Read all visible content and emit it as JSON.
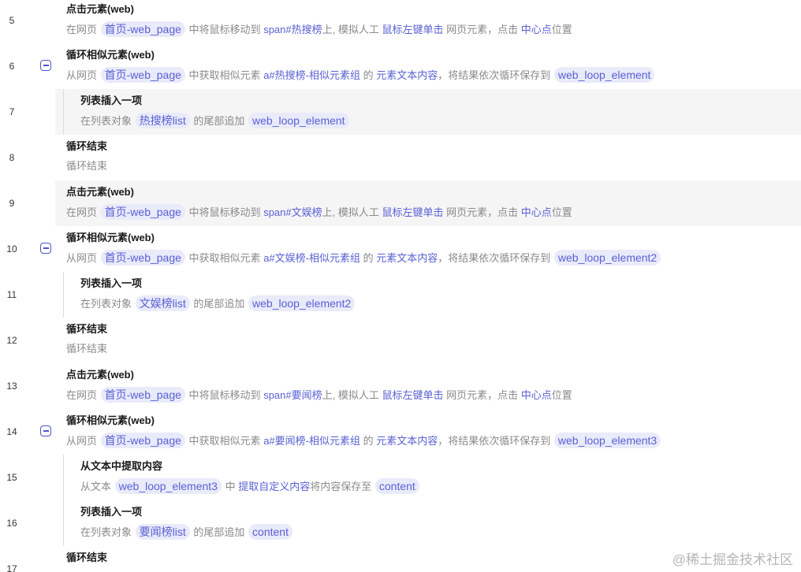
{
  "watermark": "@稀土掘金技术社区",
  "rows": {
    "r5": {
      "num": "5",
      "title": "点击元素(web)",
      "d": [
        "在网页",
        "首页-web_page",
        "中将鼠标移动到",
        "span#热搜榜",
        "上, 模拟人工",
        "鼠标左键",
        "单击",
        "网页元素，点击",
        "中心点",
        "位置"
      ]
    },
    "r6": {
      "num": "6",
      "title": "循环相似元素(web)",
      "d": [
        "从网页",
        "首页-web_page",
        "中获取相似元素",
        "a#热搜榜-相似元素组",
        "的",
        "元素文本内容",
        "，将结果依次循环保存到",
        "web_loop_element"
      ]
    },
    "r7": {
      "num": "7",
      "title": "列表插入一项",
      "d": [
        "在列表对象",
        "热搜榜list",
        "的尾部追加",
        "web_loop_element"
      ]
    },
    "r8": {
      "num": "8",
      "title": "循环结束",
      "d": [
        "循环结束"
      ]
    },
    "r9": {
      "num": "9",
      "title": "点击元素(web)",
      "d": [
        "在网页",
        "首页-web_page",
        "中将鼠标移动到",
        "span#文娱榜",
        "上, 模拟人工",
        "鼠标左键",
        "单击",
        "网页元素，点击",
        "中心点",
        "位置"
      ]
    },
    "r10": {
      "num": "10",
      "title": "循环相似元素(web)",
      "d": [
        "从网页",
        "首页-web_page",
        "中获取相似元素",
        "a#文娱榜-相似元素组",
        "的",
        "元素文本内容",
        "，将结果依次循环保存到",
        "web_loop_element2"
      ]
    },
    "r11": {
      "num": "11",
      "title": "列表插入一项",
      "d": [
        "在列表对象",
        "文娱榜list",
        "的尾部追加",
        "web_loop_element2"
      ]
    },
    "r12": {
      "num": "12",
      "title": "循环结束",
      "d": [
        "循环结束"
      ]
    },
    "r13": {
      "num": "13",
      "title": "点击元素(web)",
      "d": [
        "在网页",
        "首页-web_page",
        "中将鼠标移动到",
        "span#要闻榜",
        "上, 模拟人工",
        "鼠标左键",
        "单击",
        "网页元素，点击",
        "中心点",
        "位置"
      ]
    },
    "r14": {
      "num": "14",
      "title": "循环相似元素(web)",
      "d": [
        "从网页",
        "首页-web_page",
        "中获取相似元素",
        "a#要闻榜-相似元素组",
        "的",
        "元素文本内容",
        "，将结果依次循环保存到",
        "web_loop_element3"
      ]
    },
    "r15": {
      "num": "15",
      "title": "从文本中提取内容",
      "d": [
        "从文本",
        "web_loop_element3",
        "中",
        "提取自定义内容",
        "将内容保存至",
        "content"
      ]
    },
    "r16": {
      "num": "16",
      "title": "列表插入一项",
      "d": [
        "在列表对象",
        "要闻榜list",
        "的尾部追加",
        "content"
      ]
    },
    "r17": {
      "num": "17",
      "title": "循环结束"
    }
  }
}
